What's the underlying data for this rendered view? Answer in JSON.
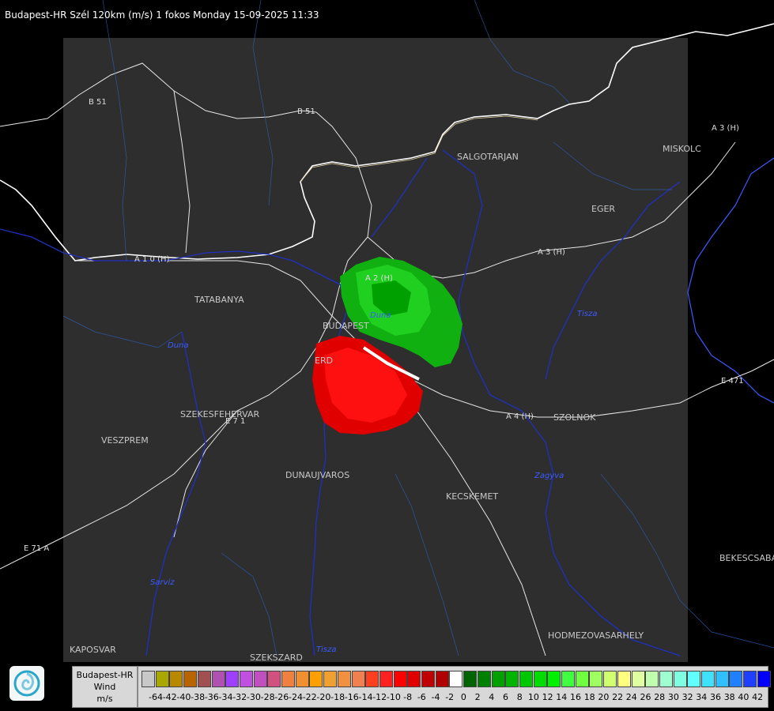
{
  "header": {
    "title": "Budapest-HR Szél 120km (m/s) 1 fokos Monday 15-09-2025 11:33"
  },
  "places": [
    "SALGOTARJAN",
    "MISKOLC",
    "EGER",
    "TATABANYA",
    "BUDAPEST",
    "ERD",
    "SZEKESFEHERVAR",
    "VESZPREM",
    "DUNAUJVAROS",
    "KECSKEMET",
    "SZOLNOK",
    "BEKESCSABA",
    "HODMEZOVASARHELY",
    "KAPOSVAR",
    "SZEKSZARD"
  ],
  "roads": [
    "B 51",
    "B 51",
    "A 3 (H)",
    "A 3 (H)",
    "A 1 0 (H)",
    "A 2 (H)",
    "A 4 (H)",
    "E 471",
    "E 7 1",
    "E 71 A"
  ],
  "rivers": [
    "Duna",
    "Duna",
    "Tisza",
    "Zagyva",
    "Sarviz",
    "Tisza"
  ],
  "legend": {
    "label_lines": [
      "Budapest-HR",
      "Wind",
      "m/s"
    ],
    "colors": [
      "#c8c8c8",
      "#a8a800",
      "#b88800",
      "#b86400",
      "#a05050",
      "#b050b0",
      "#a040ff",
      "#c050e0",
      "#c050c0",
      "#d05080",
      "#f08040",
      "#f09030",
      "#ffa000",
      "#f0a030",
      "#f09040",
      "#f08050",
      "#ff4020",
      "#ff2020",
      "#ff0000",
      "#e00000",
      "#c00000",
      "#b00000",
      "#ffffff",
      "#006400",
      "#008000",
      "#00a000",
      "#00b400",
      "#00c800",
      "#00dc00",
      "#00f000",
      "#40ff40",
      "#70ff40",
      "#a0ff60",
      "#d0ff70",
      "#ffff80",
      "#e0ffa0",
      "#c0ffb0",
      "#a0ffd0",
      "#80ffe0",
      "#60ffff",
      "#40e0ff",
      "#30c0ff",
      "#2080ff",
      "#2040ff",
      "#0000ff"
    ],
    "ticks": [
      "-64",
      "-42",
      "-40",
      "-38",
      "-36",
      "-34",
      "-32",
      "-30",
      "-28",
      "-26",
      "-24",
      "-22",
      "-20",
      "-18",
      "-16",
      "-14",
      "-12",
      "-10",
      "-8",
      "-6",
      "-4",
      "-2",
      "0",
      "2",
      "4",
      "6",
      "8",
      "10",
      "12",
      "14",
      "16",
      "18",
      "20",
      "22",
      "24",
      "26",
      "28",
      "30",
      "32",
      "34",
      "36",
      "38",
      "40",
      "42"
    ]
  }
}
